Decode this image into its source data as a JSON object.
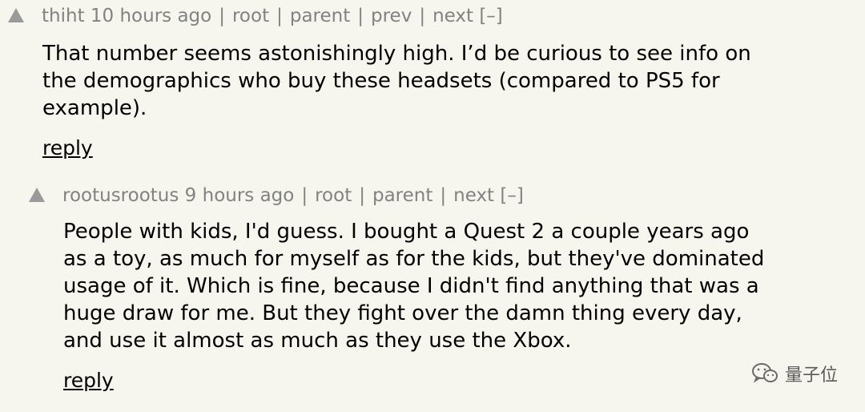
{
  "comments": [
    {
      "user": "thiht",
      "age": "10 hours ago",
      "links": [
        "root",
        "parent",
        "prev",
        "next"
      ],
      "toggle": "[–]",
      "text_lines": [
        "That number seems astonishingly high. I’d be curious to see info on",
        "the demographics who buy these headsets (compared to PS5 for",
        "example)."
      ],
      "reply": "reply"
    },
    {
      "user": "rootusrootus",
      "age": "9 hours ago",
      "links": [
        "root",
        "parent",
        "next"
      ],
      "toggle": "[–]",
      "text_lines": [
        "People with kids, I'd guess. I bought a Quest 2 a couple years ago",
        "as a toy, as much for myself as for the kids, but they've dominated",
        "usage of it. Which is fine, because I didn't find anything that was a",
        "huge draw for me. But they fight over the damn thing every day,",
        "and use it almost as much as they use the Xbox."
      ],
      "reply": "reply"
    }
  ],
  "watermark": {
    "text": "量子位",
    "icon": "wechat-icon"
  },
  "colors": {
    "background": "#f6f6ef",
    "meta": "#828282",
    "vote_arrow": "#9a9a9a"
  }
}
